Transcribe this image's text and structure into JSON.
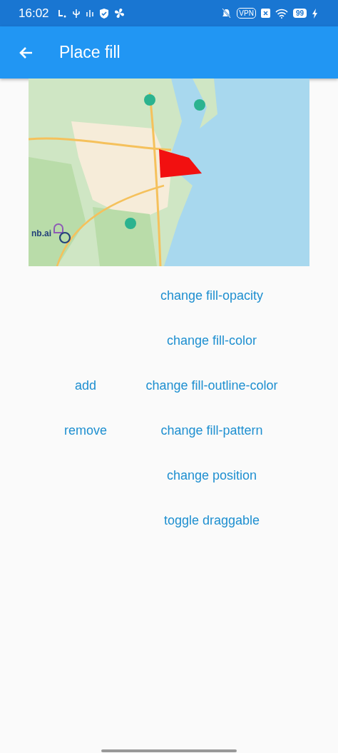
{
  "status_bar": {
    "time": "16:02",
    "vpn": "VPN",
    "battery": "99"
  },
  "app_bar": {
    "title": "Place fill"
  },
  "map": {
    "kind": "picture",
    "logo": "nb.ai"
  },
  "left_buttons": [
    "add",
    "remove"
  ],
  "right_buttons": [
    "change fill-opacity",
    "change fill-color",
    "change fill-outline-color",
    "change fill-pattern",
    "change position",
    "toggle draggable"
  ]
}
